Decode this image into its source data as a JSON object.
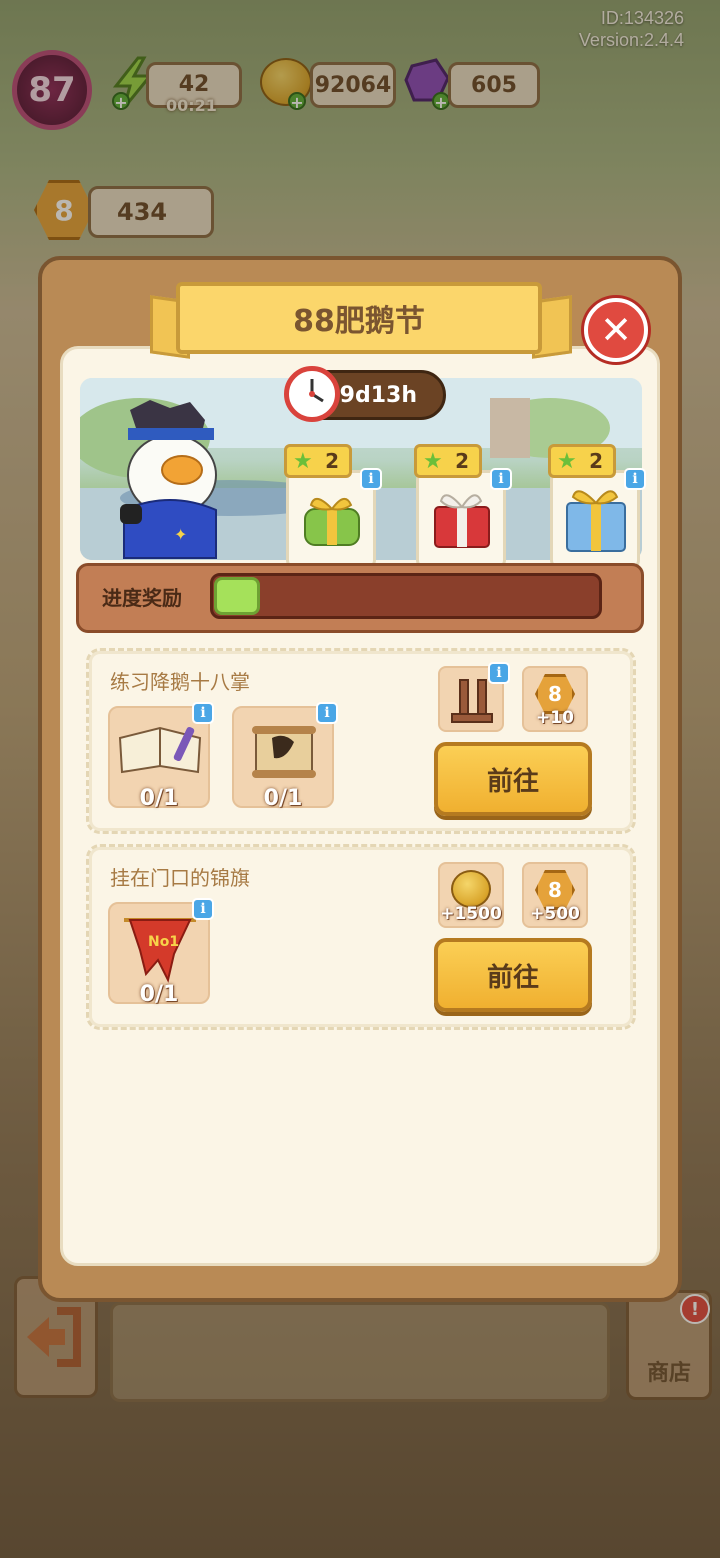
{
  "meta": {
    "id_text": "ID:134326",
    "version_text": "Version:2.4.4"
  },
  "hud": {
    "level": "87",
    "energy": {
      "value": "42",
      "timer": "00:21"
    },
    "coins": "92064",
    "gems": "605",
    "tokens": "434"
  },
  "modal": {
    "title": "88肥鹅节",
    "timer": "9d13h",
    "rewards": [
      {
        "stars": "2",
        "icon": "green-gift-icon"
      },
      {
        "stars": "2",
        "icon": "red-gift-icon"
      },
      {
        "stars": "2",
        "icon": "blue-gift-icon"
      }
    ],
    "progress_label": "进度奖励",
    "progress_fraction": 0.12
  },
  "tasks": [
    {
      "title": "练习降鹅十八掌",
      "items": [
        {
          "icon": "book-icon",
          "count": "0/1"
        },
        {
          "icon": "scroll-icon",
          "count": "0/1"
        }
      ],
      "rewards": [
        {
          "icon": "wooden-rack-icon",
          "amount": ""
        },
        {
          "icon": "token-icon",
          "amount": "+10"
        }
      ],
      "button": "前往"
    },
    {
      "title": "挂在门口的锦旗",
      "items": [
        {
          "icon": "pennant-icon",
          "count": "0/1"
        }
      ],
      "rewards": [
        {
          "icon": "coin-icon",
          "amount": "+1500"
        },
        {
          "icon": "token-icon",
          "amount": "+500"
        }
      ],
      "button": "前往"
    }
  ],
  "bottom": {
    "shop_label": "商店",
    "shop_alert": "!"
  },
  "colors": {
    "accent": "#fbd66b",
    "close": "#e04a40",
    "progress": "#a5e15a",
    "info": "#4aa6e6"
  }
}
